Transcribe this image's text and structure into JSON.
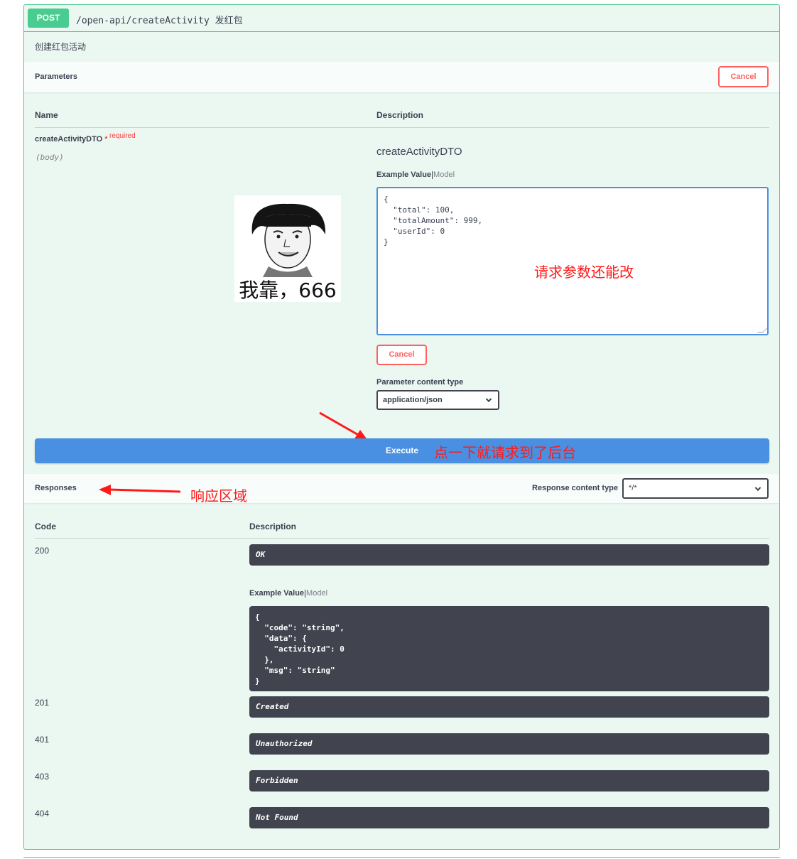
{
  "operation": {
    "method": "POST",
    "path": "/open-api/createActivity",
    "summary": "发红包",
    "description": "创建红包活动"
  },
  "parameters": {
    "title": "Parameters",
    "cancel_label": "Cancel",
    "col_name": "Name",
    "col_description": "Description",
    "param_name": "createActivityDTO",
    "param_star": " *",
    "param_required": "required",
    "param_in": "(body)",
    "model_name": "createActivityDTO",
    "tab_example": "Example Value",
    "tab_model": "Model",
    "body_value": "{\n  \"total\": 100,\n  \"totalAmount\": 999,\n  \"userId\": 0\n}",
    "editor_cancel_label": "Cancel",
    "content_type_label": "Parameter content type",
    "content_type_value": "application/json"
  },
  "meme": {
    "caption": "我靠，666"
  },
  "annotations": {
    "editable": "请求参数还能改",
    "execute_hint": "点一下就请求到了后台",
    "responses_hint": "响应区域",
    "color": "#ff1a1a"
  },
  "execute_label": "Execute",
  "responses": {
    "title": "Responses",
    "content_type_label": "Response content type",
    "content_type_value": "*/*",
    "col_code": "Code",
    "col_description": "Description",
    "tab_example": "Example Value",
    "tab_model": "Model",
    "example_value": "{\n  \"code\": \"string\",\n  \"data\": {\n    \"activityId\": 0\n  },\n  \"msg\": \"string\"\n}",
    "items": [
      {
        "code": "200",
        "description": "OK"
      },
      {
        "code": "201",
        "description": "Created"
      },
      {
        "code": "401",
        "description": "Unauthorized"
      },
      {
        "code": "403",
        "description": "Forbidden"
      },
      {
        "code": "404",
        "description": "Not Found"
      }
    ]
  },
  "colors": {
    "post": "#49cc90",
    "execute": "#4990e2",
    "cancel": "#ff6060",
    "code_bg": "#41444e"
  }
}
